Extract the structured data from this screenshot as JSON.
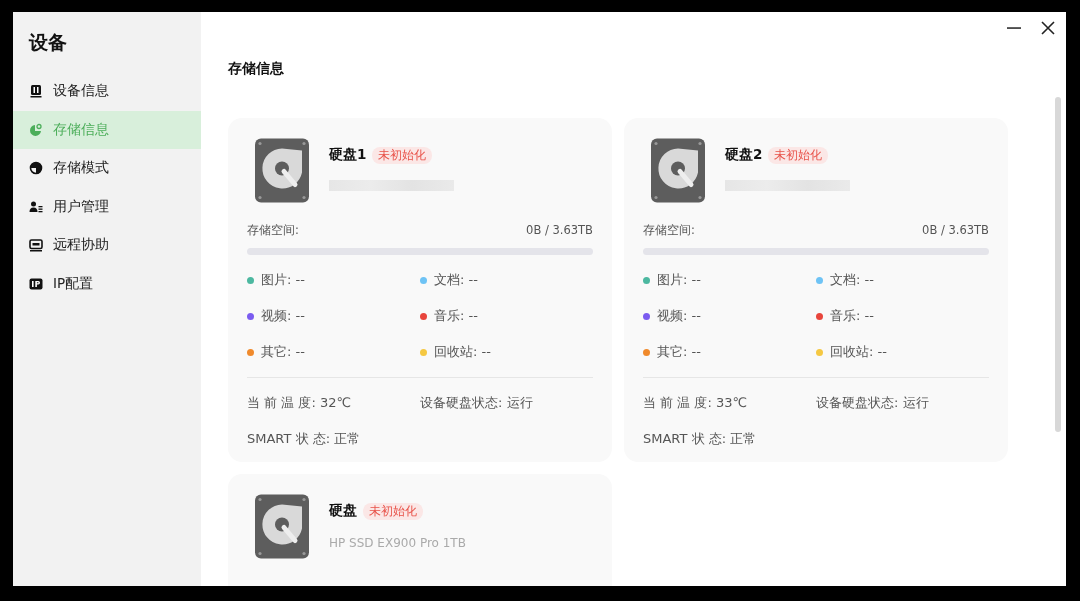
{
  "sidebar": {
    "title": "设备",
    "items": [
      {
        "label": "设备信息",
        "selected": false
      },
      {
        "label": "存储信息",
        "selected": true
      },
      {
        "label": "存储模式",
        "selected": false
      },
      {
        "label": "用户管理",
        "selected": false
      },
      {
        "label": "远程协助",
        "selected": false
      },
      {
        "label": "IP配置",
        "selected": false
      }
    ]
  },
  "content": {
    "title": "存储信息",
    "disks": [
      {
        "name": "硬盘1",
        "badge": "未初始化",
        "serial_redacted": true,
        "space_label": "存储空间:",
        "space_value": "0B / 3.63TB",
        "level": 0,
        "categories": [
          {
            "label": "图片: --",
            "color": "#4cb8a0"
          },
          {
            "label": "文档: --",
            "color": "#6ec3f5"
          },
          {
            "label": "视频: --",
            "color": "#7b5cf0"
          },
          {
            "label": "音乐: --",
            "color": "#e8453c"
          },
          {
            "label": "其它: --",
            "color": "#f08a2c"
          },
          {
            "label": "回收站: --",
            "color": "#f5c842"
          }
        ],
        "status": [
          "当 前 温 度: 32℃",
          "设备硬盘状态: 运行",
          "SMART 状 态: 正常"
        ]
      },
      {
        "name": "硬盘2",
        "badge": "未初始化",
        "serial_redacted": true,
        "space_label": "存储空间:",
        "space_value": "0B / 3.63TB",
        "level": 0,
        "categories": [
          {
            "label": "图片: --",
            "color": "#4cb8a0"
          },
          {
            "label": "文档: --",
            "color": "#6ec3f5"
          },
          {
            "label": "视频: --",
            "color": "#7b5cf0"
          },
          {
            "label": "音乐: --",
            "color": "#e8453c"
          },
          {
            "label": "其它: --",
            "color": "#f08a2c"
          },
          {
            "label": "回收站: --",
            "color": "#f5c842"
          }
        ],
        "status": [
          "当 前 温 度: 33℃",
          "设备硬盘状态: 运行",
          "SMART 状 态: 正常"
        ]
      },
      {
        "name": "硬盘",
        "badge": "未初始化",
        "serial_redacted": false,
        "model": "HP SSD EX900 Pro 1TB"
      }
    ]
  }
}
